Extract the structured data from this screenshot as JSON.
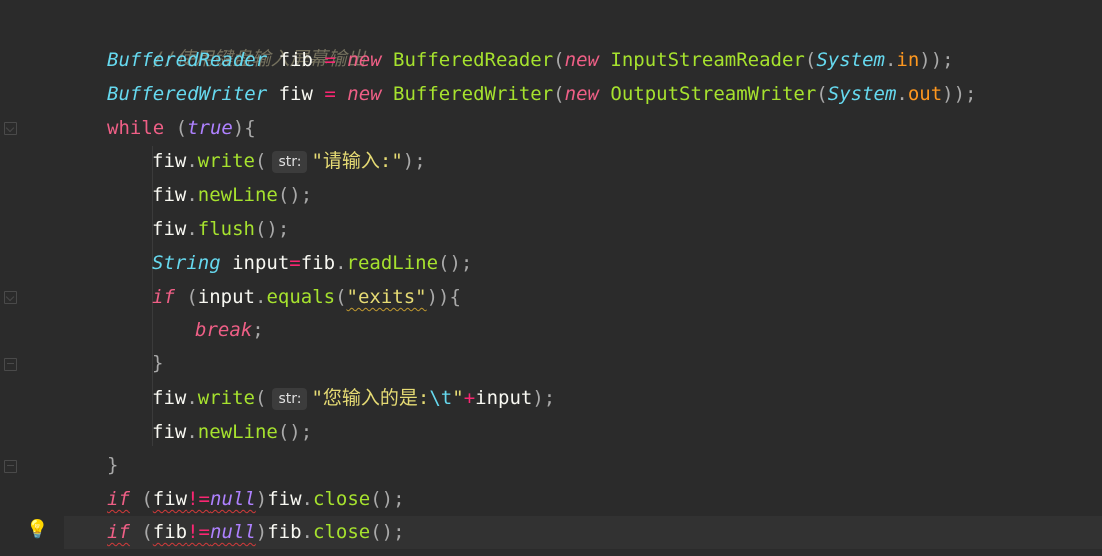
{
  "editor": {
    "comment": "//使用键盘输入屏幕输出",
    "lines": {
      "l1": {
        "t1": "BufferedReader",
        "v1": " fib ",
        "op": "=",
        "k": " new ",
        "c1": "BufferedReader",
        "p1": "(",
        "k2": "new ",
        "c2": "InputStreamReader",
        "p2": "(",
        "t2": "System",
        ".": ".",
        "f": "in",
        "p3": "));"
      },
      "l2": {
        "t1": "BufferedWriter",
        "v1": " fiw ",
        "op": "=",
        "k": " new ",
        "c1": "BufferedWriter",
        "p1": "(",
        "k2": "new ",
        "c2": "OutputStreamWriter",
        "p2": "(",
        "t2": "System",
        ".": ".",
        "f": "out",
        "p3": "));"
      },
      "l3": {
        "k": "while",
        "p1": " (",
        "b": "true",
        "p2": "){"
      },
      "l4": {
        "v": "fiw",
        ".": ".",
        "m": "write",
        "p1": "(",
        "hint": "str:",
        "s": "\"请输入:\"",
        "p2": ");"
      },
      "l5": {
        "v": "fiw",
        ".": ".",
        "m": "newLine",
        "p": "();"
      },
      "l6": {
        "v": "fiw",
        ".": ".",
        "m": "flush",
        "p": "();"
      },
      "l7": {
        "t": "String",
        "v": " input",
        "op": "=",
        "v2": "fib",
        ".": ".",
        "m": "readLine",
        "p": "();"
      },
      "l8": {
        "k": "if",
        "p1": " (",
        "v": "input",
        ".": ".",
        "m": "equals",
        "p2": "(",
        "s": "\"exits\"",
        "p3": ")){"
      },
      "l9": {
        "k": "break",
        "p": ";"
      },
      "l10": {
        "p": "}"
      },
      "l11": {
        "v": "fiw",
        ".": ".",
        "m": "write",
        "p1": "(",
        "hint": "str:",
        "s1": "\"您输入的是:",
        "e": "\\t",
        "s2": "\"",
        "op": "+",
        "v2": "input",
        "p2": ");"
      },
      "l12": {
        "v": "fiw",
        ".": ".",
        "m": "newLine",
        "p": "();"
      },
      "l13": {
        "p": "}"
      },
      "l14": {
        "k": "if",
        "p1": " (",
        "v": "fiw",
        "op": "!=",
        "n": "null",
        "p2": ")",
        "v2": "fiw",
        ".": ".",
        "m": "close",
        "p3": "();"
      },
      "l15": {
        "k": "if",
        "p1": " (",
        "v": "fib",
        "op": "!=",
        "n": "null",
        "p2": ")",
        "v2": "fib",
        ".": ".",
        "m": "close",
        "p3": "();"
      }
    }
  },
  "gutter": {
    "bulb_icon": "lightbulb-icon",
    "bulb_glyph": "💡"
  },
  "colors": {
    "background": "#2b2b2b",
    "keyword": "#ef5f86",
    "string": "#e6db74",
    "method": "#a6e22e",
    "type": "#66d9ef"
  }
}
